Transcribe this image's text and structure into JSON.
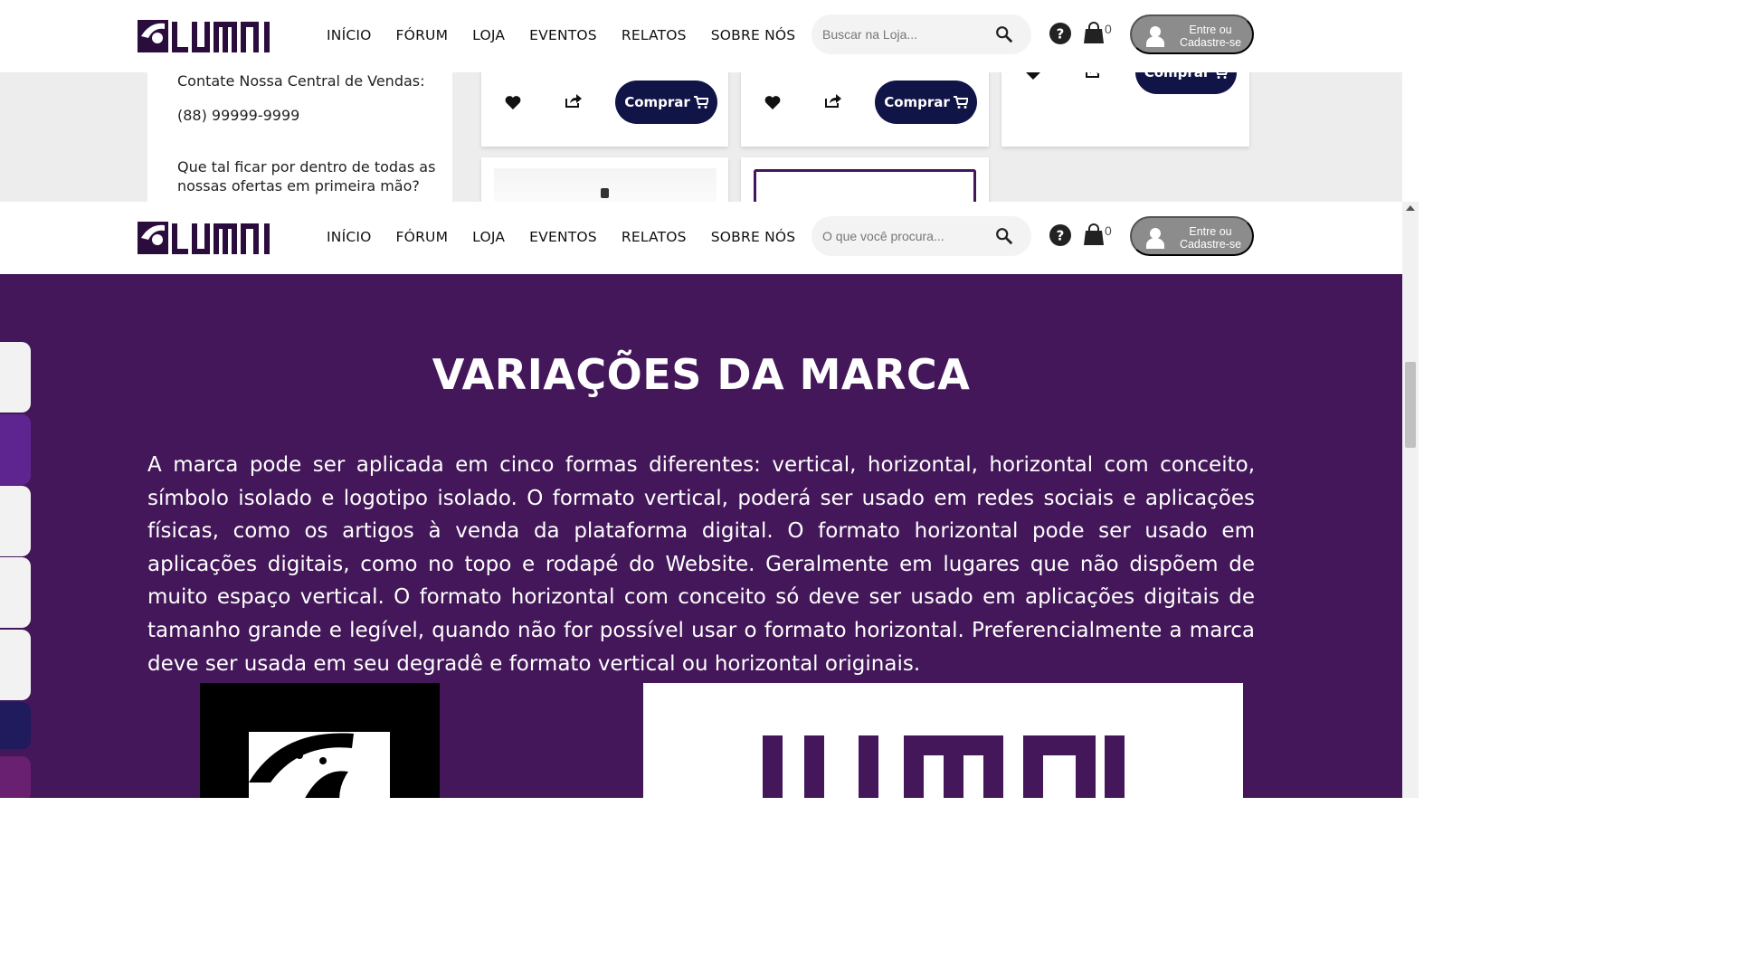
{
  "header": {
    "logo_text": "LUMNI",
    "nav": [
      "INÍCIO",
      "FÓRUM",
      "LOJA",
      "EVENTOS",
      "RELATOS",
      "SOBRE NÓS"
    ],
    "search_placeholder_store": "Buscar na Loja...",
    "search_placeholder_site": "O que você procura...",
    "cart_count": "0",
    "login_label": "Entre ou Cadastre-se"
  },
  "store": {
    "contact_title": "Contate Nossa Central de Vendas:",
    "contact_phone": "(88) 99999-9999",
    "newsletter_line1": "Que tal ficar por dentro de todas as",
    "newsletter_line2": "nossas ofertas em primeira mão?",
    "buy_label": "Comprar"
  },
  "brand": {
    "title": "VARIAÇÕES DA MARCA",
    "text": "A marca pode ser aplicada em cinco formas diferentes: vertical, horizontal, horizontal com conceito, símbolo isolado e logotipo isolado. O formato vertical, poderá ser usado em redes sociais e aplicações físicas, como os artigos à venda da plataforma digital. O formato horizontal pode ser usado em aplicações digitais, como no topo e rodapé do Website. Geralmente em lugares que não dispõem de muito espaço vertical. O formato horizontal com conceito só deve ser usado em aplicações digitais de tamanho grande e legível, quando não for possível usar o formato horizontal. Preferencialmente a marca deve ser usada em seu degradê e formato vertical ou horizontal originais."
  },
  "colors": {
    "brand_purple": "#431759",
    "button_navy": "#111446",
    "tab_colors": [
      "#f2f2f2",
      "#5e2590",
      "#f2f2f2",
      "#f2f2f2",
      "#f2f2f2",
      "#1f1b5c",
      "#6a2070"
    ]
  },
  "icons": [
    "search-icon",
    "help-icon",
    "shopping-bag-icon",
    "user-icon",
    "heart-icon",
    "share-icon",
    "cart-icon"
  ]
}
